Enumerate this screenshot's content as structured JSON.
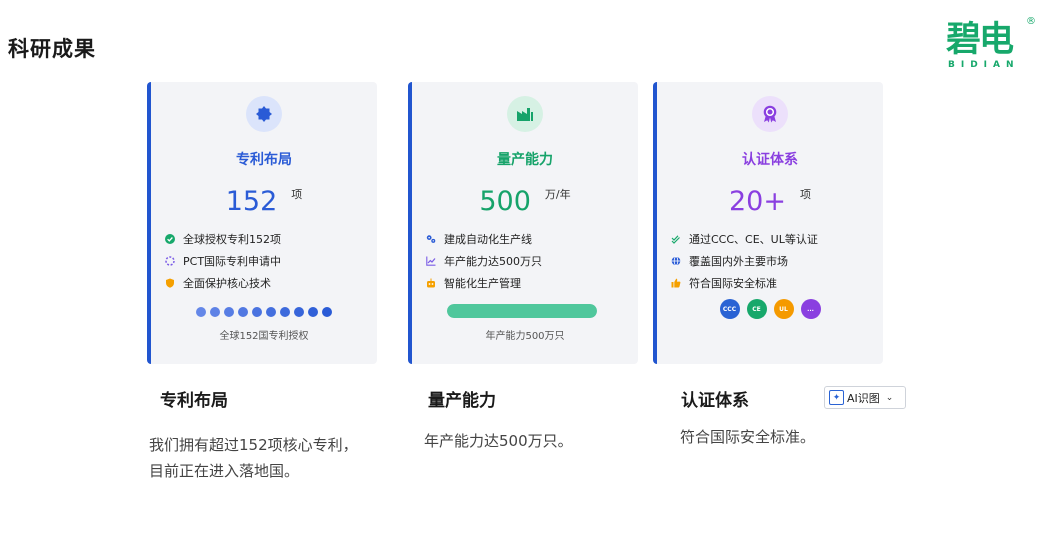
{
  "page": {
    "title": "科研成果"
  },
  "brand": {
    "mark": "碧电",
    "sub": "BIDIAN",
    "reg": "®",
    "color": "#17a86b"
  },
  "cards": [
    {
      "title": "专利布局",
      "value": "152",
      "unit": "项",
      "accent": "#2a5bd6",
      "icon": "badge-icon",
      "features": [
        {
          "icon": "check-circle-icon",
          "text": "全球授权专利152项",
          "color": "#17a86b"
        },
        {
          "icon": "spinner-icon",
          "text": "PCT国际专利申请中",
          "color": "#7b5ce6"
        },
        {
          "icon": "shield-icon",
          "text": "全面保护核心技术",
          "color": "#f5a000"
        }
      ],
      "dots_count": 10,
      "caption": "全球152国专利授权"
    },
    {
      "title": "量产能力",
      "value": "500",
      "unit": "万/年",
      "accent": "#16a36a",
      "icon": "factory-icon",
      "features": [
        {
          "icon": "gears-icon",
          "text": "建成自动化生产线",
          "color": "#2a5bd6"
        },
        {
          "icon": "line-chart-icon",
          "text": "年产能力达500万只",
          "color": "#7b5ce6"
        },
        {
          "icon": "robot-icon",
          "text": "智能化生产管理",
          "color": "#f5a000"
        }
      ],
      "progress": 1.0,
      "caption": "年产能力500万只"
    },
    {
      "title": "认证体系",
      "value": "20+",
      "unit": "项",
      "accent": "#8a3fe0",
      "icon": "award-icon",
      "features": [
        {
          "icon": "double-check-icon",
          "text": "通过CCC、CE、UL等认证",
          "color": "#17a86b"
        },
        {
          "icon": "globe-icon",
          "text": "覆盖国内外主要市场",
          "color": "#2a5bd6"
        },
        {
          "icon": "thumbs-up-icon",
          "text": "符合国际安全标准",
          "color": "#f5a000"
        }
      ],
      "badges": [
        {
          "label": "CCC",
          "color": "#2a63d4"
        },
        {
          "label": "CE",
          "color": "#17a86b"
        },
        {
          "label": "UL",
          "color": "#f59a00"
        },
        {
          "label": "...",
          "color": "#8a3fe0"
        }
      ]
    }
  ],
  "sections": [
    {
      "title": "专利布局",
      "desc": "我们拥有超过152项核心专利，\n目前正在进入落地国。"
    },
    {
      "title": "量产能力",
      "desc": "年产能力达500万只。"
    },
    {
      "title": "认证体系",
      "desc": "符合国际安全标准。"
    }
  ],
  "ai_button": {
    "label": "AI识图",
    "icon": "ai-sparkle-icon",
    "chevron": "chevron-down-icon"
  }
}
